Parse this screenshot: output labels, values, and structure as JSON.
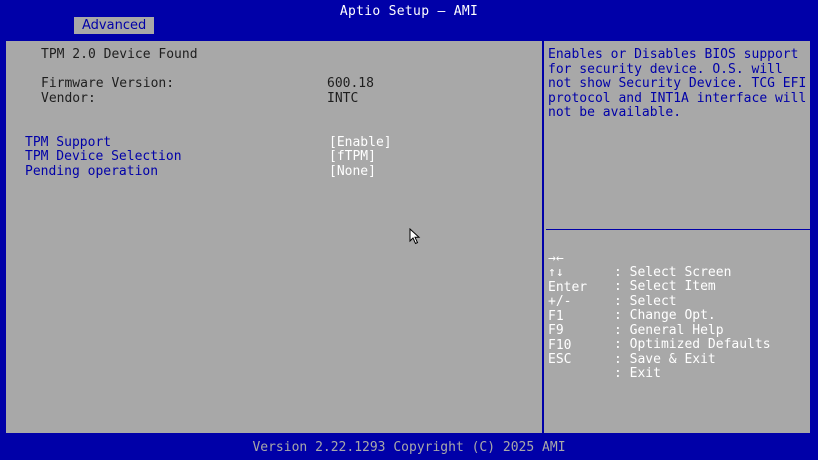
{
  "title_bar": {
    "title": "Aptio Setup – AMI",
    "tab": "Advanced"
  },
  "main": {
    "heading": "TPM 2.0 Device Found",
    "info": [
      {
        "label": "Firmware Version:",
        "value": "600.18"
      },
      {
        "label": "Vendor:",
        "value": "INTC"
      }
    ],
    "items": [
      {
        "label": "TPM Support",
        "value": "[Enable]"
      },
      {
        "label": "TPM Device Selection",
        "value": "[fTPM]"
      },
      {
        "label": "Pending operation",
        "value": "[None]"
      }
    ]
  },
  "help": {
    "text": "Enables or Disables BIOS support for security device. O.S. will not show Security Device. TCG EFI protocol and INT1A interface will not be available.",
    "keys": [
      {
        "key": "→←",
        "desc": ": Select Screen"
      },
      {
        "key": "↑↓",
        "desc": ": Select Item"
      },
      {
        "key": "Enter",
        "desc": ": Select"
      },
      {
        "key": "+/-",
        "desc": ": Change Opt."
      },
      {
        "key": "F1",
        "desc": ": General Help"
      },
      {
        "key": "F9",
        "desc": ": Optimized Defaults"
      },
      {
        "key": "F10",
        "desc": ": Save & Exit"
      },
      {
        "key": "ESC",
        "desc": ": Exit"
      }
    ]
  },
  "footer": {
    "text": "Version 2.22.1293 Copyright (C) 2025 AMI"
  },
  "colors": {
    "bios_blue": "#0000a8",
    "panel_gray": "#a8a8a8",
    "highlight_white": "#ffffff"
  },
  "icons": {
    "cursor": "mouse-pointer-icon"
  }
}
